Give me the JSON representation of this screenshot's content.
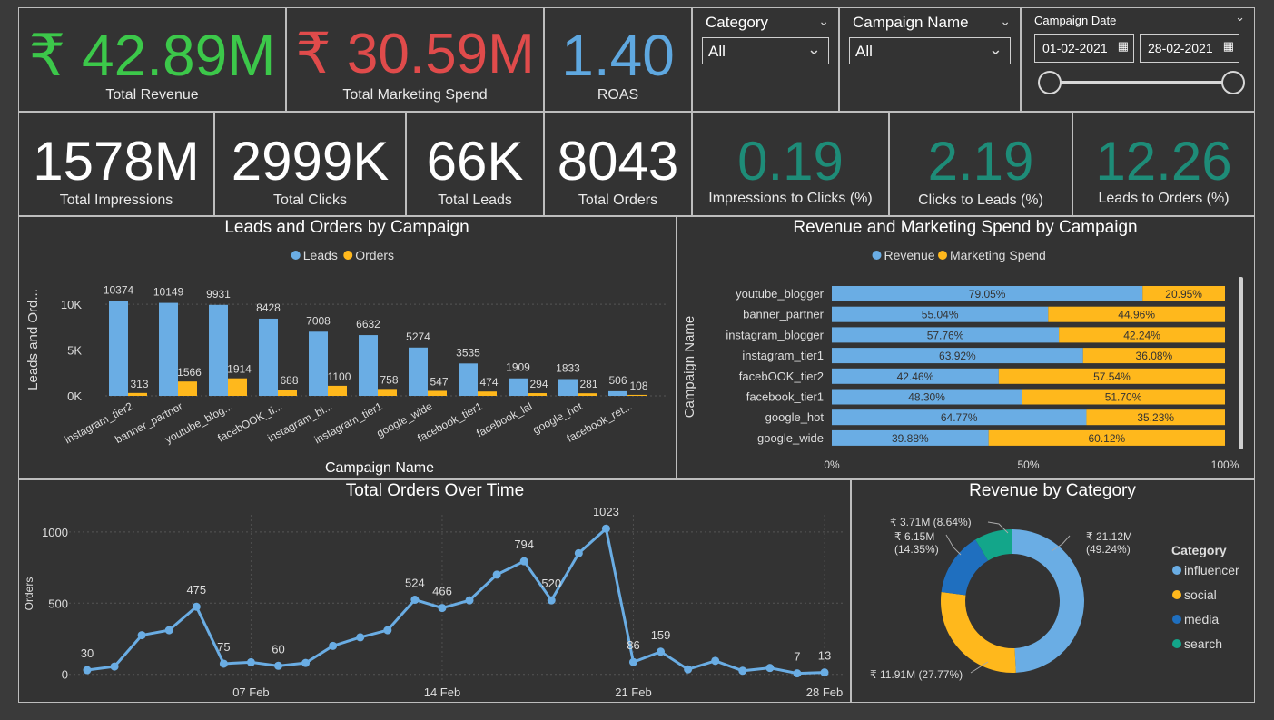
{
  "kpis_top": [
    {
      "value": "₹ 42.89M",
      "label": "Total Revenue",
      "color": "#3cc84a"
    },
    {
      "value": "₹ 30.59M",
      "label": "Total Marketing Spend",
      "color": "#e04b4b"
    },
    {
      "value": "1.40",
      "label": "ROAS",
      "color": "#5fa8e0"
    }
  ],
  "slicers": {
    "category": {
      "title": "Category",
      "value": "All"
    },
    "campaign": {
      "title": "Campaign Name",
      "value": "All"
    },
    "date": {
      "title": "Campaign Date",
      "start": "01-02-2021",
      "end": "28-02-2021"
    }
  },
  "kpis_bottom": [
    {
      "value": "1578M",
      "label": "Total Impressions",
      "color": "#ffffff"
    },
    {
      "value": "2999K",
      "label": "Total Clicks",
      "color": "#ffffff"
    },
    {
      "value": "66K",
      "label": "Total Leads",
      "color": "#ffffff"
    },
    {
      "value": "8043",
      "label": "Total Orders",
      "color": "#ffffff"
    },
    {
      "value": "0.19",
      "label": "Impressions to Clicks (%)",
      "color": "#1e8c78"
    },
    {
      "value": "2.19",
      "label": "Clicks to Leads (%)",
      "color": "#1e8c78"
    },
    {
      "value": "12.26",
      "label": "Leads to Orders (%)",
      "color": "#1e8c78"
    }
  ],
  "chart_data": [
    {
      "type": "bar",
      "title": "Leads and Orders by Campaign",
      "xlabel": "Campaign Name",
      "ylabel": "Leads and Ord...",
      "legend": "top",
      "ylim": [
        0,
        11000
      ],
      "yticks": [
        "0K",
        "5K",
        "10K"
      ],
      "categories": [
        "instagram_tier2",
        "banner_partner",
        "youtube_blog...",
        "facebOOK_ti...",
        "instagram_bl...",
        "instagram_tier1",
        "google_wide",
        "facebook_tier1",
        "facebook_lal",
        "google_hot",
        "facebook_ret..."
      ],
      "series": [
        {
          "name": "Leads",
          "color": "#6aade4",
          "values": [
            10374,
            10149,
            9931,
            8428,
            7008,
            6632,
            5274,
            3535,
            1909,
            1833,
            506
          ]
        },
        {
          "name": "Orders",
          "color": "#ffb81c",
          "values": [
            313,
            1566,
            1914,
            688,
            1100,
            758,
            547,
            474,
            294,
            281,
            108
          ]
        }
      ]
    },
    {
      "type": "bar",
      "orientation": "horizontal-100%-stacked",
      "title": "Revenue and Marketing Spend by Campaign",
      "ylabel": "Campaign Name",
      "legend": "top",
      "xticks": [
        "0%",
        "50%",
        "100%"
      ],
      "categories": [
        "youtube_blogger",
        "banner_partner",
        "instagram_blogger",
        "instagram_tier1",
        "facebOOK_tier2",
        "facebook_tier1",
        "google_hot",
        "google_wide"
      ],
      "series": [
        {
          "name": "Revenue",
          "color": "#6aade4",
          "values": [
            79.05,
            55.04,
            57.76,
            63.92,
            42.46,
            48.3,
            64.77,
            39.88
          ],
          "labels": [
            "79.05%",
            "55.04%",
            "57.76%",
            "63.92%",
            "42.46%",
            "48.30%",
            "64.77%",
            "39.88%"
          ]
        },
        {
          "name": "Marketing Spend",
          "color": "#ffb81c",
          "values": [
            20.95,
            44.96,
            42.24,
            36.08,
            57.54,
            51.7,
            35.23,
            60.12
          ],
          "labels": [
            "20.95%",
            "44.96%",
            "42.24%",
            "36.08%",
            "57.54%",
            "51.70%",
            "35.23%",
            "60.12%"
          ]
        }
      ]
    },
    {
      "type": "line",
      "title": "Total Orders Over Time",
      "ylabel": "Orders",
      "ylim": [
        -40,
        1120
      ],
      "yticks": [
        0,
        500,
        1000
      ],
      "xlim": [
        1,
        28
      ],
      "xticks": [
        {
          "x": 7,
          "label": "07 Feb"
        },
        {
          "x": 14,
          "label": "14 Feb"
        },
        {
          "x": 21,
          "label": "21 Feb"
        },
        {
          "x": 28,
          "label": "28 Feb"
        }
      ],
      "color": "#6aade4",
      "x": [
        1,
        2,
        3,
        4,
        5,
        6,
        7,
        8,
        9,
        10,
        11,
        12,
        13,
        14,
        15,
        16,
        17,
        18,
        19,
        20,
        21,
        22,
        23,
        24,
        25,
        26,
        27,
        28
      ],
      "values": [
        30,
        55,
        275,
        310,
        475,
        75,
        85,
        60,
        80,
        200,
        260,
        310,
        524,
        466,
        520,
        700,
        794,
        520,
        850,
        1023,
        86,
        159,
        35,
        95,
        25,
        45,
        7,
        13
      ],
      "labels": {
        "1": "30",
        "5": "475",
        "6": "75",
        "8": "60",
        "13": "524",
        "14": "466",
        "17": "794",
        "18": "520",
        "20": "1023",
        "21": "86",
        "22": "159",
        "27": "7",
        "28": "13"
      }
    },
    {
      "type": "pie",
      "subtype": "donut",
      "title": "Revenue by Category",
      "legend_title": "Category",
      "legend": "right",
      "categories": [
        "influencer",
        "social",
        "media",
        "search"
      ],
      "values": [
        21.12,
        11.91,
        6.15,
        3.71
      ],
      "colors": [
        "#6aade4",
        "#ffb81c",
        "#1f6fbf",
        "#13a68a"
      ],
      "labels": [
        "₹ 21.12M\n(49.24%)",
        "₹ 11.91M (27.77%)",
        "₹ 6.15M\n(14.35%)",
        "₹ 3.71M (8.64%)"
      ]
    }
  ]
}
